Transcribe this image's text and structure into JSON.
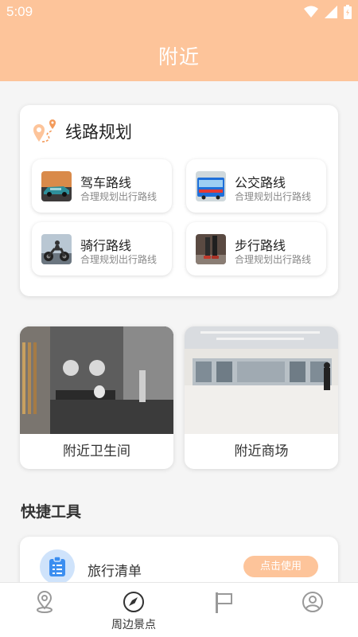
{
  "status_bar": {
    "time": "5:09"
  },
  "header": {
    "title": "附近"
  },
  "route_planning": {
    "title": "线路规划",
    "items": [
      {
        "name": "驾车路线",
        "subtitle": "合理规划出行路线",
        "thumb_icon": "car-photo"
      },
      {
        "name": "公交路线",
        "subtitle": "合理规划出行路线",
        "thumb_icon": "bus-photo"
      },
      {
        "name": "骑行路线",
        "subtitle": "合理规划出行路线",
        "thumb_icon": "motorcycle-photo"
      },
      {
        "name": "步行路线",
        "subtitle": "合理规划出行路线",
        "thumb_icon": "walking-photo"
      }
    ]
  },
  "places": [
    {
      "label": "附近卫生间",
      "image": "restroom-photo"
    },
    {
      "label": "附近商场",
      "image": "mall-photo"
    }
  ],
  "quick_tools": {
    "title": "快捷工具",
    "items": [
      {
        "name": "旅行清单",
        "button": "点击使用",
        "icon": "checklist-icon"
      }
    ]
  },
  "tabs": [
    {
      "label": "",
      "icon": "location-pin-icon"
    },
    {
      "label": "周边景点",
      "icon": "compass-icon",
      "active": true
    },
    {
      "label": "",
      "icon": "flag-icon"
    },
    {
      "label": "",
      "icon": "user-icon"
    }
  ],
  "colors": {
    "accent": "#fdc49a",
    "accent_dark": "#f39b5c",
    "tool_icon_bg": "#cfe3fb",
    "tool_icon": "#3b8ef0"
  }
}
